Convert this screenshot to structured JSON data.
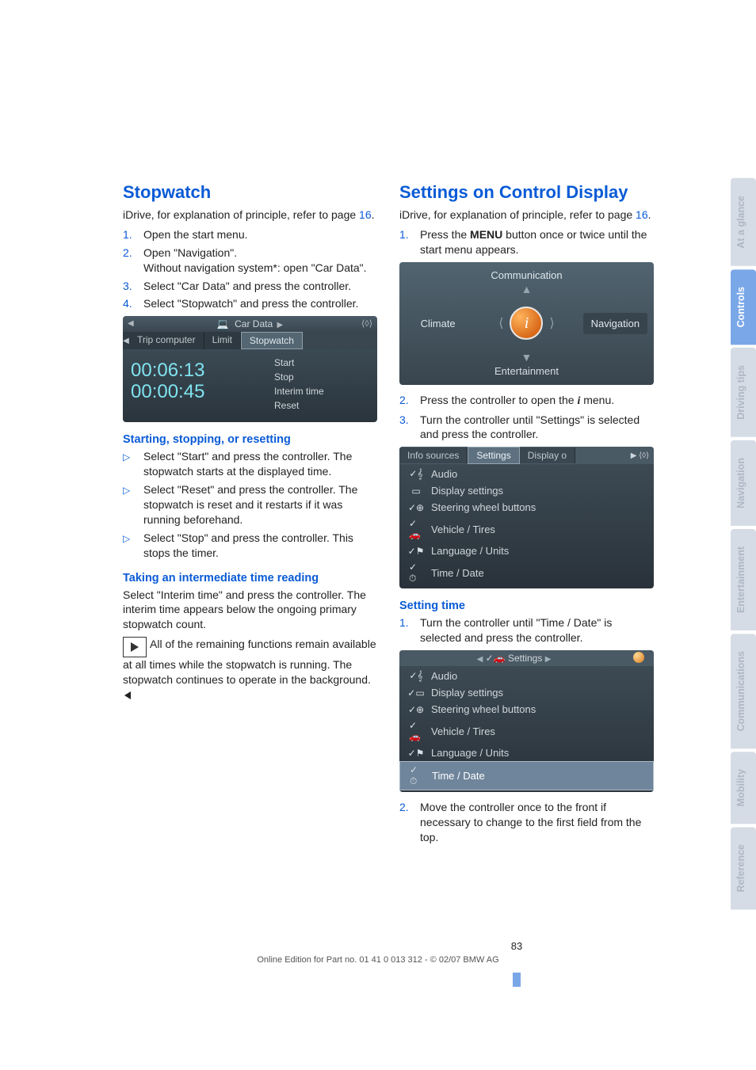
{
  "page_number": "83",
  "footer_line": "Online Edition for Part no. 01 41 0 013 312 - © 02/07 BMW AG",
  "left": {
    "heading": "Stopwatch",
    "intro_a": "iDrive, for explanation of principle, refer to page ",
    "intro_pg": "16",
    "intro_b": ".",
    "steps": [
      "Open the start menu.",
      "Open \"Navigation\".\nWithout navigation system*: open \"Car Data\".",
      "Select \"Car Data\" and press the controller.",
      "Select \"Stopwatch\" and press the controller."
    ],
    "shot1": {
      "title": "Car Data",
      "tabs": [
        "Trip computer",
        "Limit",
        "Stopwatch"
      ],
      "time1": "00:06:13",
      "time2": "00:00:45",
      "opts": [
        "Start",
        "Stop",
        "Interim time",
        "Reset"
      ]
    },
    "sub1": "Starting, stopping, or resetting",
    "bullets": [
      "Select \"Start\" and press the controller. The stopwatch starts at the displayed time.",
      "Select \"Reset\" and press the controller. The stopwatch is reset and it restarts if it was running beforehand.",
      "Select \"Stop\" and press the controller. This stops the timer."
    ],
    "sub2": "Taking an intermediate time reading",
    "interim_p": "Select \"Interim time\" and press the controller. The interim time appears below the ongoing primary stopwatch count.",
    "note": "All of the remaining functions remain available at all times while the stopwatch is running. The stopwatch continues to operate in the background."
  },
  "right": {
    "heading": "Settings on Control Display",
    "intro_a": "iDrive, for explanation of principle, refer to page ",
    "intro_pg": "16",
    "intro_b": ".",
    "step1_a": "Press the ",
    "step1_menu": "MENU",
    "step1_b": " button once or twice until the start menu appears.",
    "shot2": {
      "top": "Communication",
      "left": "Climate",
      "rightlbl": "Navigation",
      "bottom": "Entertainment"
    },
    "step2_a": "Press the controller to open the ",
    "step2_i": "i",
    "step2_b": " menu.",
    "step3": "Turn the controller until \"Settings\" is selected and press the controller.",
    "shot3": {
      "tabs": [
        "Info sources",
        "Settings",
        "Display o"
      ],
      "rows": [
        "Audio",
        "Display settings",
        "Steering wheel buttons",
        "Vehicle / Tires",
        "Language / Units",
        "Time / Date"
      ]
    },
    "sub1": "Setting time",
    "time_step1": "Turn the controller until \"Time / Date\" is selected and press the controller.",
    "shot4": {
      "header": "Settings",
      "rows": [
        "Audio",
        "Display settings",
        "Steering wheel buttons",
        "Vehicle / Tires",
        "Language / Units",
        "Time / Date"
      ]
    },
    "time_step2": "Move the controller once to the front if necessary to change to the first field from the top."
  },
  "sidetabs": [
    {
      "label": "At a glance",
      "active": false
    },
    {
      "label": "Controls",
      "active": true
    },
    {
      "label": "Driving tips",
      "active": false
    },
    {
      "label": "Navigation",
      "active": false
    },
    {
      "label": "Entertainment",
      "active": false
    },
    {
      "label": "Communications",
      "active": false
    },
    {
      "label": "Mobility",
      "active": false
    },
    {
      "label": "Reference",
      "active": false
    }
  ]
}
